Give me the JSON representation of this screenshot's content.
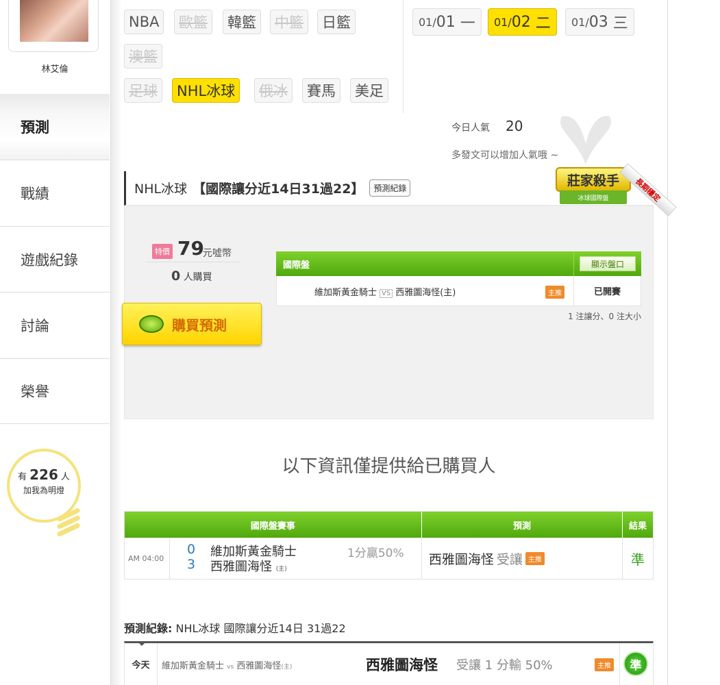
{
  "user": {
    "name": "林艾倫"
  },
  "sidebar": {
    "items": [
      {
        "label": "預測"
      },
      {
        "label": "戰績"
      },
      {
        "label": "遊戲紀錄"
      },
      {
        "label": "討論"
      },
      {
        "label": "榮譽"
      }
    ],
    "lamp": {
      "prefix": "有",
      "count": "226",
      "suffix": "人",
      "caption": "加我為明燈"
    }
  },
  "sports": [
    {
      "label": "NBA",
      "state": "normal"
    },
    {
      "label": "歐籃",
      "state": "disabled"
    },
    {
      "label": "韓籃",
      "state": "normal"
    },
    {
      "label": "中籃",
      "state": "disabled"
    },
    {
      "label": "日籃",
      "state": "normal"
    },
    {
      "label": "澳籃",
      "state": "disabled"
    },
    {
      "label": "足球",
      "state": "disabled"
    },
    {
      "label": "NHL冰球",
      "state": "selected"
    },
    {
      "label": "俄冰",
      "state": "disabled"
    },
    {
      "label": "賽馬",
      "state": "normal"
    },
    {
      "label": "美足",
      "state": "normal"
    }
  ],
  "dates": [
    {
      "md": "01/",
      "d": "01",
      "wd": "一",
      "state": "normal"
    },
    {
      "md": "01/",
      "d": "02",
      "wd": "二",
      "state": "selected"
    },
    {
      "md": "01/",
      "d": "03",
      "wd": "三",
      "state": "normal"
    }
  ],
  "popularity": {
    "label": "今日人氣",
    "count": "20",
    "hint": "多發文可以增加人氣哦 ~"
  },
  "prediction": {
    "sport": "NHL冰球",
    "title": "【國際讓分近14日31過22】",
    "record_button": "預測紀錄",
    "badge": {
      "main": "莊家殺手",
      "sub": "冰球國際盤",
      "ribbon": "長期穩定"
    },
    "special_label": "特價",
    "price": "79",
    "price_unit": "元噓幣",
    "buyers_count": "0",
    "buyers_label": "人購買",
    "buy_button": "購買預測",
    "coin_label": "噓"
  },
  "market": {
    "header": "國際盤",
    "show_button": "顯示盤口",
    "away": "維加斯黃金騎士",
    "vs": "VS",
    "home": "西雅圖海怪(主)",
    "host_tag": "主推",
    "status": "已開賽",
    "note": "1 注讓分、0 注大小"
  },
  "purchased_notice": "以下資訊僅提供給已購買人",
  "result_table": {
    "headers": [
      "國際盤賽事",
      "預測",
      "結果"
    ],
    "row": {
      "time": "AM 04:00",
      "away_score": "0",
      "home_score": "3",
      "away": "維加斯黃金騎士",
      "home": "西雅圖海怪",
      "home_mark": "(主)",
      "handicap": "1分贏50%",
      "pick": "西雅圖海怪",
      "pick_type": "受讓",
      "host_tag": "主推",
      "result": "準"
    }
  },
  "log": {
    "label": "預測紀錄:",
    "title": "NHL冰球 國際讓分近14日 31過22",
    "row": {
      "day": "今天",
      "away": "維加斯黃金騎士",
      "vs": "vs",
      "home": "西雅圖海怪",
      "home_mark": "(主)",
      "pick": "西雅圖海怪",
      "condition": "受讓 1 分輸 50%",
      "host_tag": "主推",
      "result": "準"
    }
  }
}
